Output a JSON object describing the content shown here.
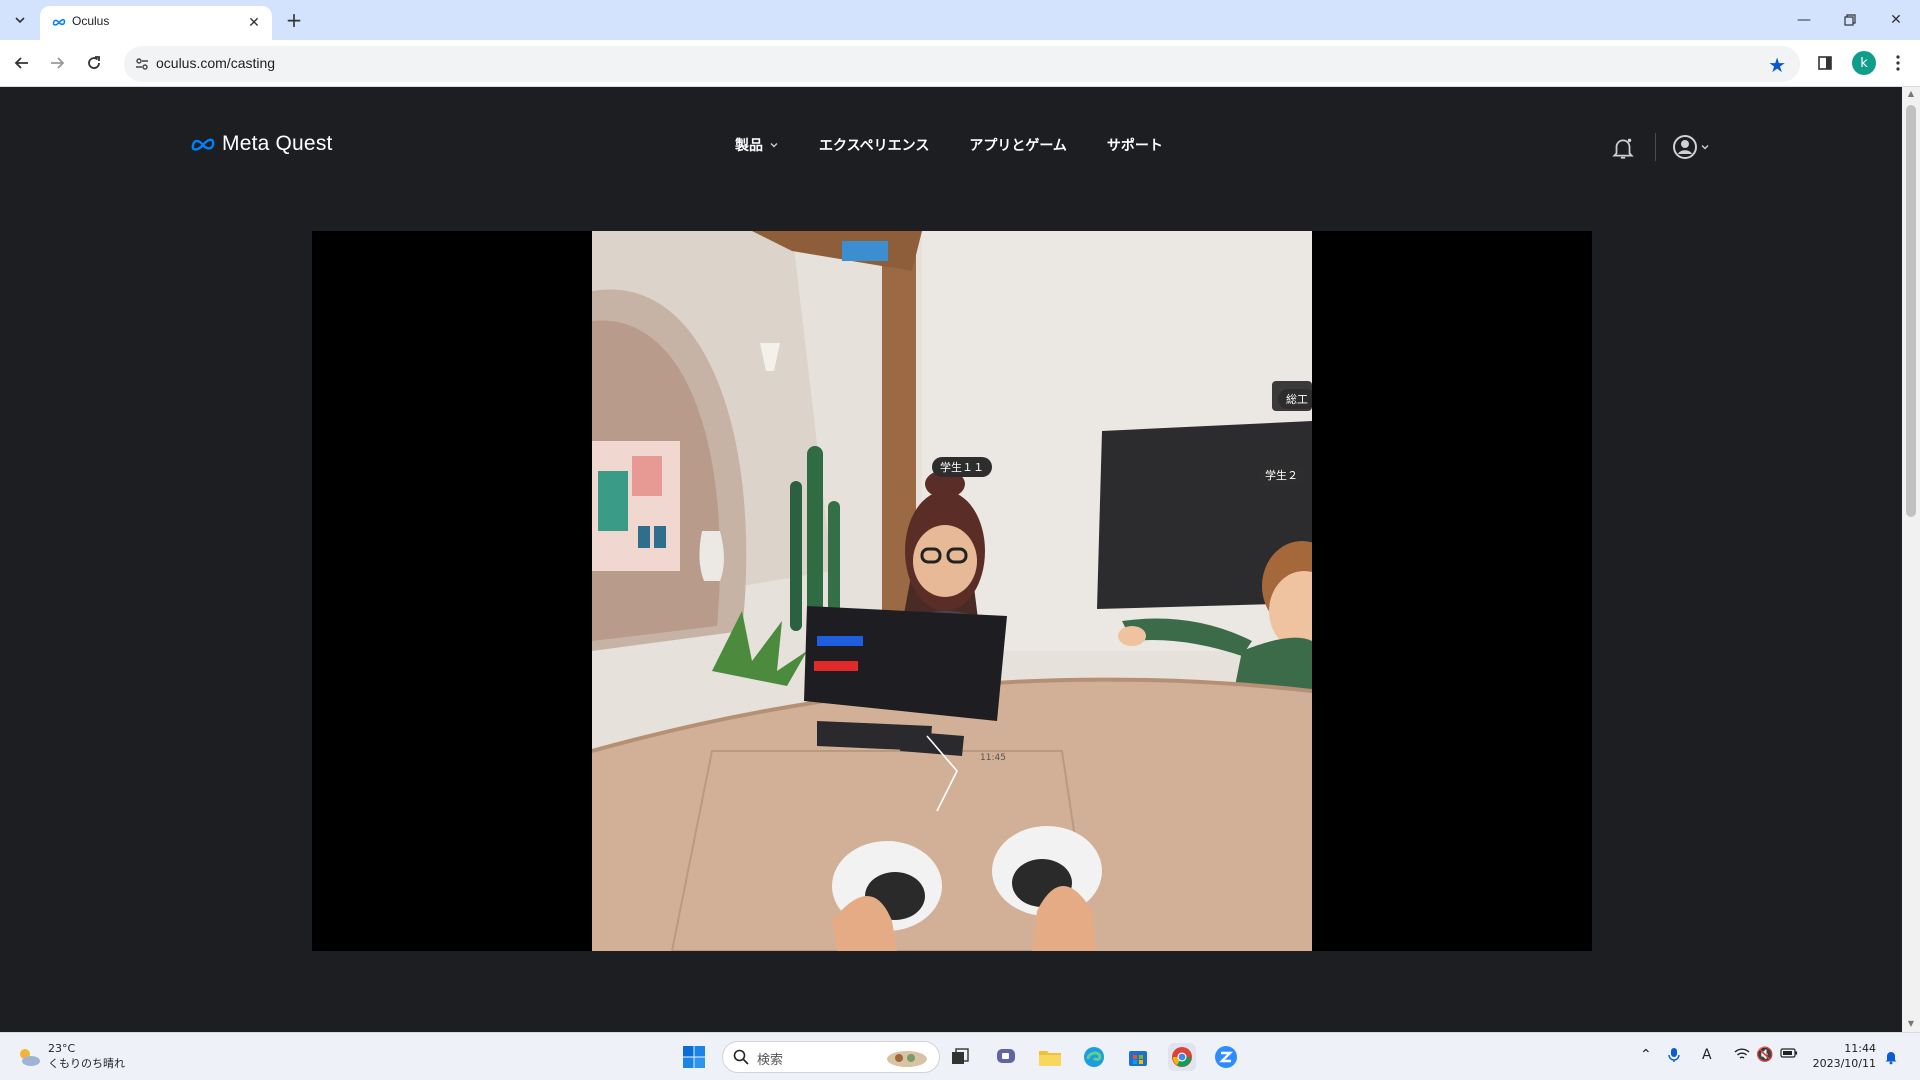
{
  "browser": {
    "tab_title": "Oculus",
    "url": "oculus.com/casting",
    "profile_initial": "k"
  },
  "site": {
    "brand": "Meta Quest",
    "nav": [
      {
        "label": "製品",
        "has_dropdown": true
      },
      {
        "label": "エクスペリエンス",
        "has_dropdown": false
      },
      {
        "label": "アプリとゲーム",
        "has_dropdown": false
      },
      {
        "label": "サポート",
        "has_dropdown": false
      }
    ]
  },
  "vr_scene": {
    "name_tags": [
      "学生１１",
      "学生２",
      "総工"
    ],
    "panel_time": "11:45"
  },
  "taskbar": {
    "weather_temp": "23°C",
    "weather_condition": "くもりのち晴れ",
    "search_placeholder": "検索",
    "time": "11:44",
    "date": "2023/10/11"
  },
  "colors": {
    "page_bg": "#1c1e21",
    "tabstrip_bg": "#d3e3fd",
    "accent_blue": "#0b57d0",
    "meta_blue": "#0081fb"
  }
}
